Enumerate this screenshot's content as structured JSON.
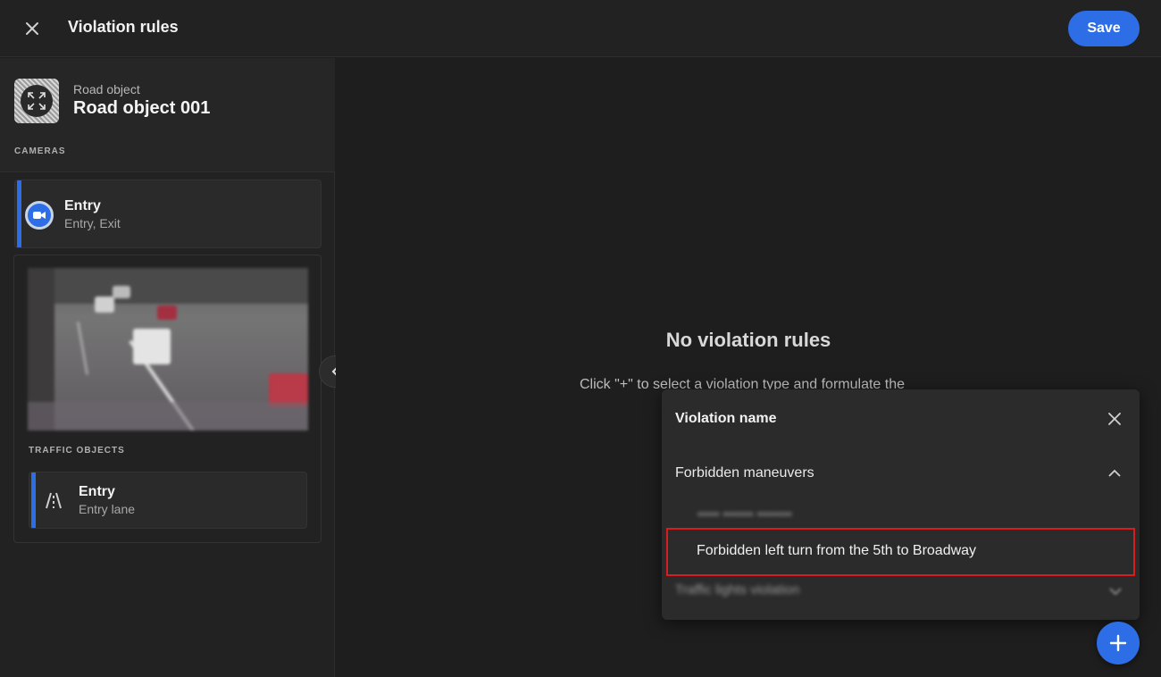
{
  "header": {
    "title": "Violation rules",
    "save_label": "Save",
    "close_icon": "close-icon"
  },
  "sidebar": {
    "object_kind": "Road object",
    "object_name": "Road object 001",
    "cameras_label": "CAMERAS",
    "camera": {
      "title": "Entry",
      "subtitle": "Entry, Exit",
      "icon": "video-camera-icon"
    },
    "traffic_objects_label": "TRAFFIC OBJECTS",
    "lane": {
      "title": "Entry",
      "subtitle": "Entry lane",
      "icon": "road-lane-icon"
    }
  },
  "main": {
    "empty_title": "No violation rules",
    "empty_desc": "Click \"+\" to select a violation type and formulate the"
  },
  "dropdown": {
    "title": "Violation name",
    "group_label": "Forbidden maneuvers",
    "blurred_item": "••••• ••••••• ••••••••",
    "selected_item": "Forbidden left turn from the 5th to Broadway",
    "second_group": "Traffic lights violation"
  },
  "colors": {
    "accent": "#2d6ee6",
    "highlight": "#d91c1c",
    "background": "#1e1e1e"
  }
}
